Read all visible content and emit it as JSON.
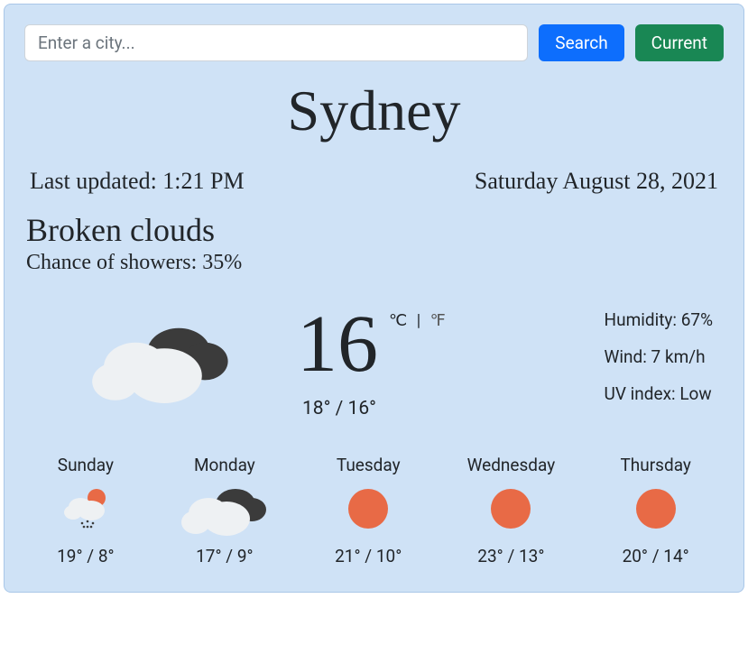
{
  "search": {
    "placeholder": "Enter a city...",
    "value": "",
    "search_label": "Search",
    "current_label": "Current"
  },
  "city": "Sydney",
  "last_updated": "Last updated: 1:21 PM",
  "date": "Saturday August 28, 2021",
  "condition": "Broken clouds",
  "chance": "Chance of showers: 35%",
  "current": {
    "temp": "16",
    "unit_c": "℃",
    "unit_sep": "|",
    "unit_f": "℉",
    "hilo": "18° / 16°",
    "humidity": "Humidity: 67%",
    "wind": "Wind: 7 km/h",
    "uv": "UV index: Low",
    "icon": "broken-clouds"
  },
  "forecast": [
    {
      "day": "Sunday",
      "icon": "rain-sun",
      "temps": "19° / 8°"
    },
    {
      "day": "Monday",
      "icon": "broken-clouds",
      "temps": "17° / 9°"
    },
    {
      "day": "Tuesday",
      "icon": "sun",
      "temps": "21° / 10°"
    },
    {
      "day": "Wednesday",
      "icon": "sun",
      "temps": "23° / 13°"
    },
    {
      "day": "Thursday",
      "icon": "sun",
      "temps": "20° / 14°"
    }
  ]
}
